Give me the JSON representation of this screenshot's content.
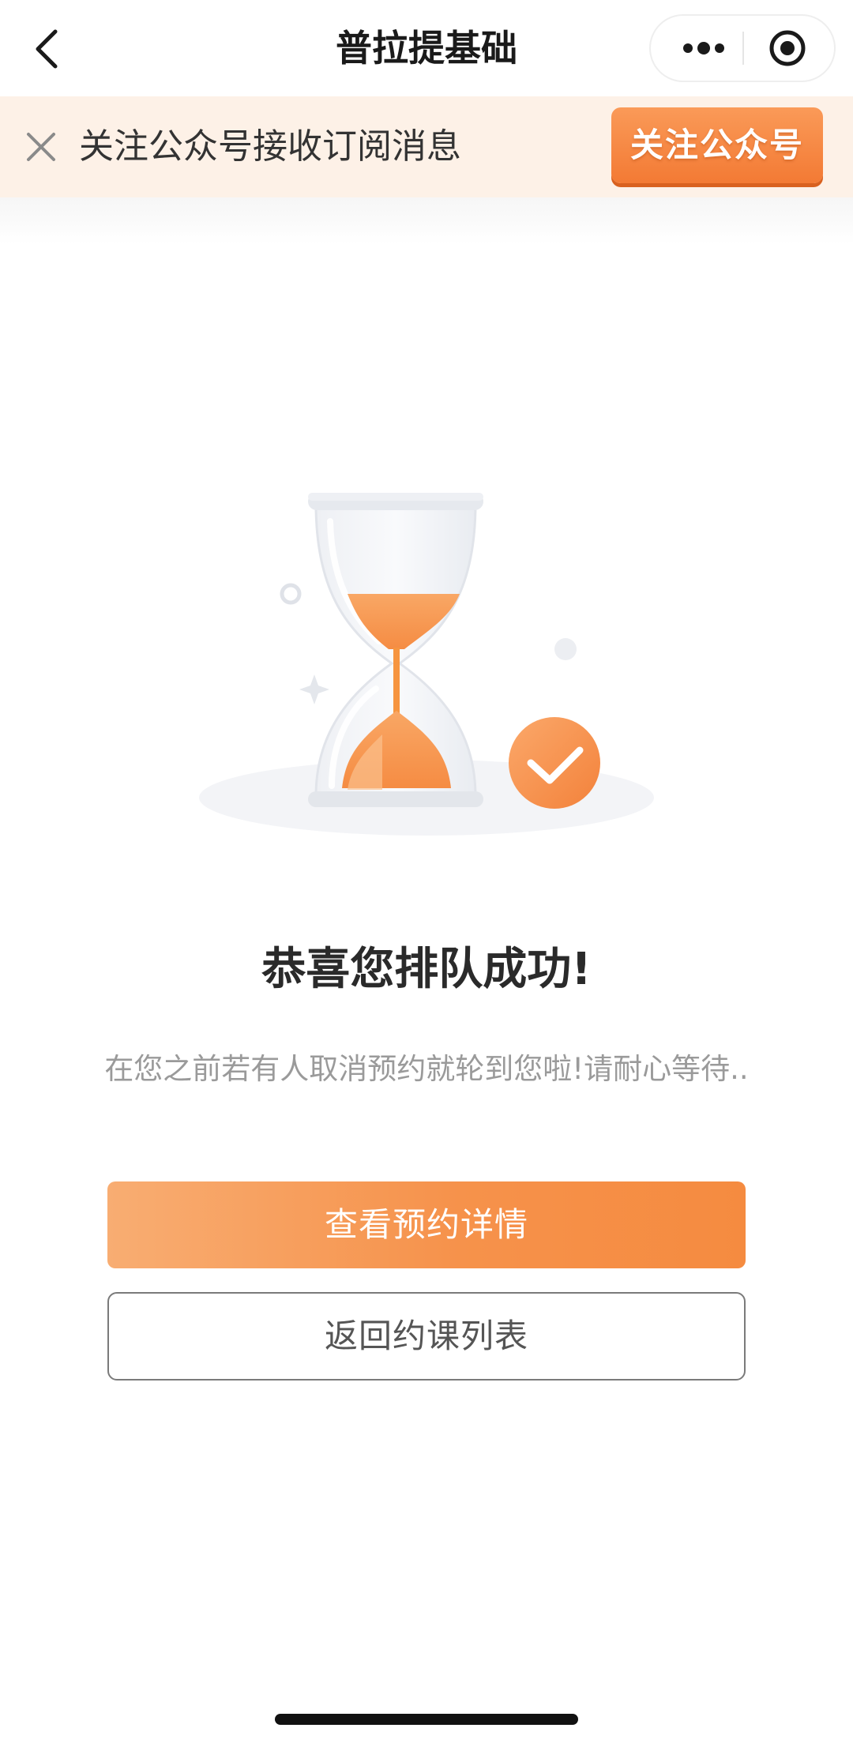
{
  "nav": {
    "title": "普拉提基础",
    "back_icon": "chevron-left-icon",
    "more_icon": "more-dots-icon",
    "close_icon": "target-circle-icon"
  },
  "banner": {
    "text": "关注公众号接收订阅消息",
    "follow_button": "关注公众号",
    "close_icon": "close-icon",
    "background": "#fdf1e7",
    "button_color": "#f37a34"
  },
  "illustration": {
    "icon": "hourglass-icon",
    "badge_icon": "check-circle-icon",
    "accent": "#f5924a"
  },
  "result": {
    "title": "恭喜您排队成功!",
    "subtitle": "在您之前若有人取消预约就轮到您啦!请耐心等待.."
  },
  "actions": {
    "view_details": "查看预约详情",
    "back_to_list": "返回约课列表"
  }
}
